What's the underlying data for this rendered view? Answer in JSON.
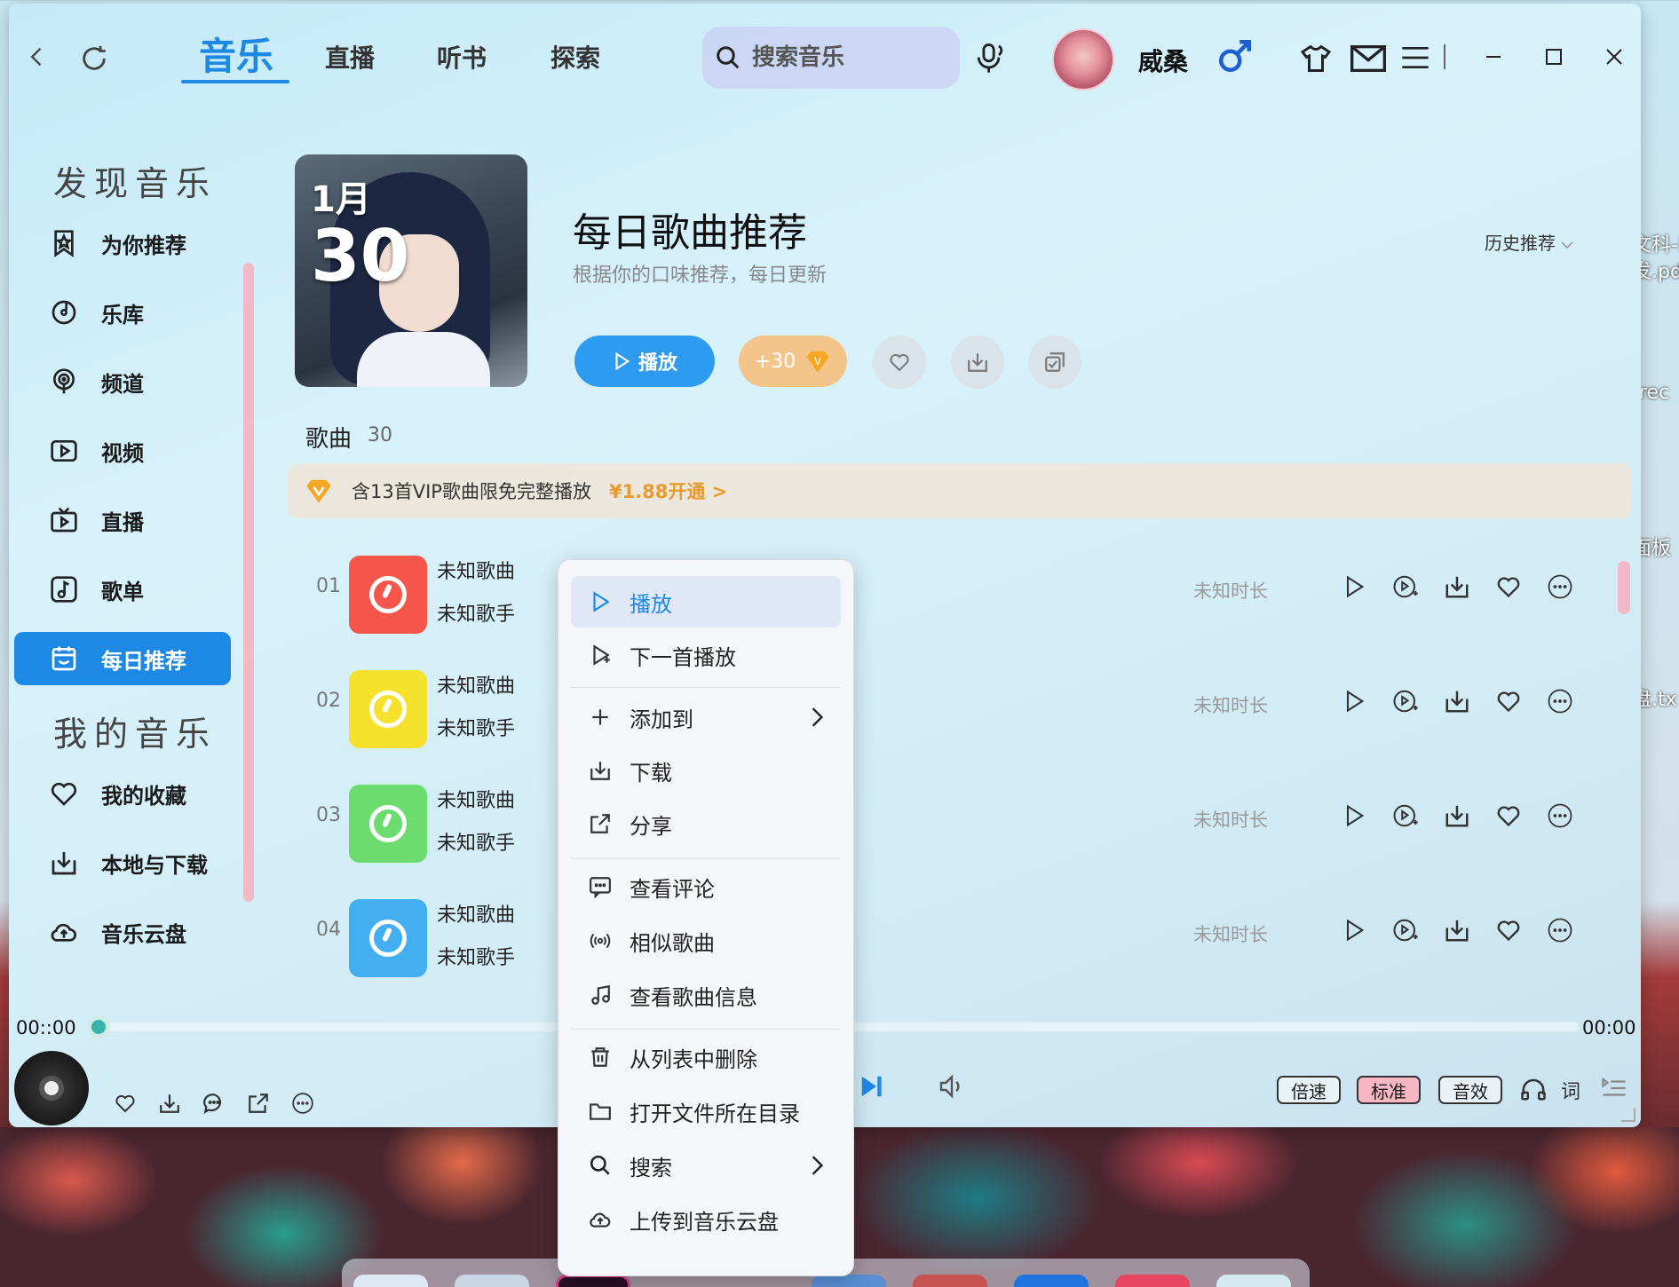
{
  "nav": {
    "tabs": [
      "音乐",
      "直播",
      "听书",
      "探索"
    ],
    "search_placeholder": "搜索音乐",
    "username": "威桑"
  },
  "sidebar": {
    "section_discover": "发现音乐",
    "discover_items": [
      "为你推荐",
      "乐库",
      "频道",
      "视频",
      "直播",
      "歌单",
      "每日推荐"
    ],
    "section_mine": "我的音乐",
    "mine_items": [
      "我的收藏",
      "本地与下载",
      "音乐云盘"
    ]
  },
  "header": {
    "cover_month": "1月",
    "cover_day": "30",
    "title": "每日歌曲推荐",
    "subtitle": "根据你的口味推荐，每日更新",
    "history": "历史推荐",
    "play": "播放",
    "plus": "+30",
    "vip_badge": "V"
  },
  "songs": {
    "label": "歌曲",
    "count": "30",
    "vip_notice": "含13首VIP歌曲限免完整播放",
    "vip_link": "¥1.88开通 >",
    "rows": [
      {
        "num": "01",
        "name": "未知歌曲",
        "artist": "未知歌手",
        "duration": "未知时长",
        "color": "#f4564b"
      },
      {
        "num": "02",
        "name": "未知歌曲",
        "artist": "未知歌手",
        "duration": "未知时长",
        "color": "#f6e12d"
      },
      {
        "num": "03",
        "name": "未知歌曲",
        "artist": "未知歌手",
        "duration": "未知时长",
        "color": "#6cdc6f"
      },
      {
        "num": "04",
        "name": "未知歌曲",
        "artist": "未知歌手",
        "duration": "未知时长",
        "color": "#43aef0"
      }
    ]
  },
  "player": {
    "time_current": "00::00",
    "time_total": "00:00",
    "speed": "倍速",
    "quality": "标准",
    "effect": "音效",
    "lyric": "词"
  },
  "context_menu": {
    "items": [
      "播放",
      "下一首播放",
      "添加到",
      "下载",
      "分享",
      "查看评论",
      "相似歌曲",
      "查看歌曲信息",
      "从列表中删除",
      "打开文件所在目录",
      "搜索",
      "上传到音乐云盘"
    ]
  },
  "desktop": {
    "items": [
      "文科-载",
      "发.pdf",
      "-rec",
      "面板",
      "盘.tx"
    ]
  },
  "colors": {
    "accent": "#1e88e5",
    "vip_orange": "#e89a2b",
    "sidebar_scroll": "#f1b8c6"
  }
}
